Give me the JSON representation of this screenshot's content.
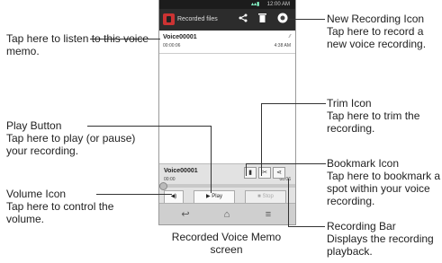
{
  "phone": {
    "status_time": "12:00 AM",
    "status_icons": "signal-wifi-battery",
    "title": "Recorded files",
    "share_icon": "<",
    "delete_icon": "▮",
    "record_icon": "●",
    "recording": {
      "name": "Voice00001",
      "duration": "00:00:06",
      "time": "4:38 AM"
    },
    "player": {
      "name": "Voice00001",
      "elapsed": "00:00",
      "total": "00:06",
      "play_label": "▶ Play",
      "stop_label": "■ Stop",
      "volume_label": "◀)",
      "progress": 0
    },
    "nav": {
      "back": "↩",
      "home": "⌂",
      "menu": "≡"
    }
  },
  "callouts": {
    "listen": {
      "desc": "Tap here to listen to this voice memo."
    },
    "new_rec": {
      "title": "New Recording Icon",
      "desc": "Tap here to record a new voice recording."
    },
    "trim": {
      "title": "Trim Icon",
      "desc": "Tap here to trim the recording."
    },
    "play": {
      "title": "Play Button",
      "desc": "Tap here to play (or pause) your recording."
    },
    "bookmark": {
      "title": "Bookmark Icon",
      "desc": "Tap here to bookmark a spot within your voice recording."
    },
    "volume": {
      "title": "Volume Icon",
      "desc": "Tap here to control the volume."
    },
    "bar": {
      "title": "Recording Bar",
      "desc": "Displays the recording playback."
    }
  },
  "caption": "Recorded Voice Memo screen"
}
